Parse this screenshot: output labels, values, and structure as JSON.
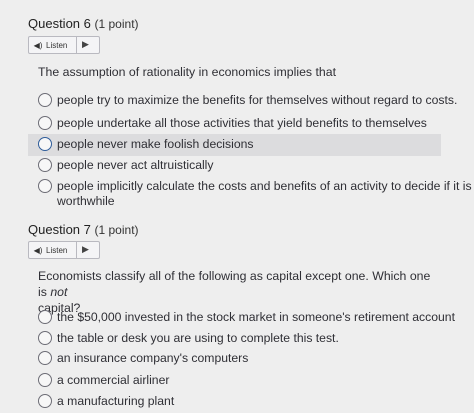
{
  "q6": {
    "title": "Question 6",
    "points": "(1 point)",
    "listen": "Listen",
    "prompt": "The assumption of rationality in economics implies that",
    "options": [
      "people try to maximize the benefits for themselves without regard to costs.",
      "people undertake all those activities that yield benefits to themselves",
      "people never make foolish decisions",
      "people never act altruistically",
      "people implicitly calculate the costs and benefits of an activity to decide if it is",
      "worthwhile"
    ]
  },
  "q7": {
    "title": "Question 7",
    "points": "(1 point)",
    "listen": "Listen",
    "prompt_line1_a": "Economists classify all of the following as capital except one. Which one is ",
    "prompt_line1_b": "not",
    "prompt_line2": "capital?",
    "options": [
      "the $50,000 invested in the stock market in someone's retirement account",
      "the table or desk you are using to complete this test.",
      "an insurance company's computers",
      "a commercial airliner",
      "a manufacturing plant"
    ]
  },
  "colors": {
    "highlight": "#dcdcde",
    "selected_ring": "#2e5c9a"
  },
  "icons": {
    "speaker": "speaker-icon",
    "play": "play-icon"
  }
}
